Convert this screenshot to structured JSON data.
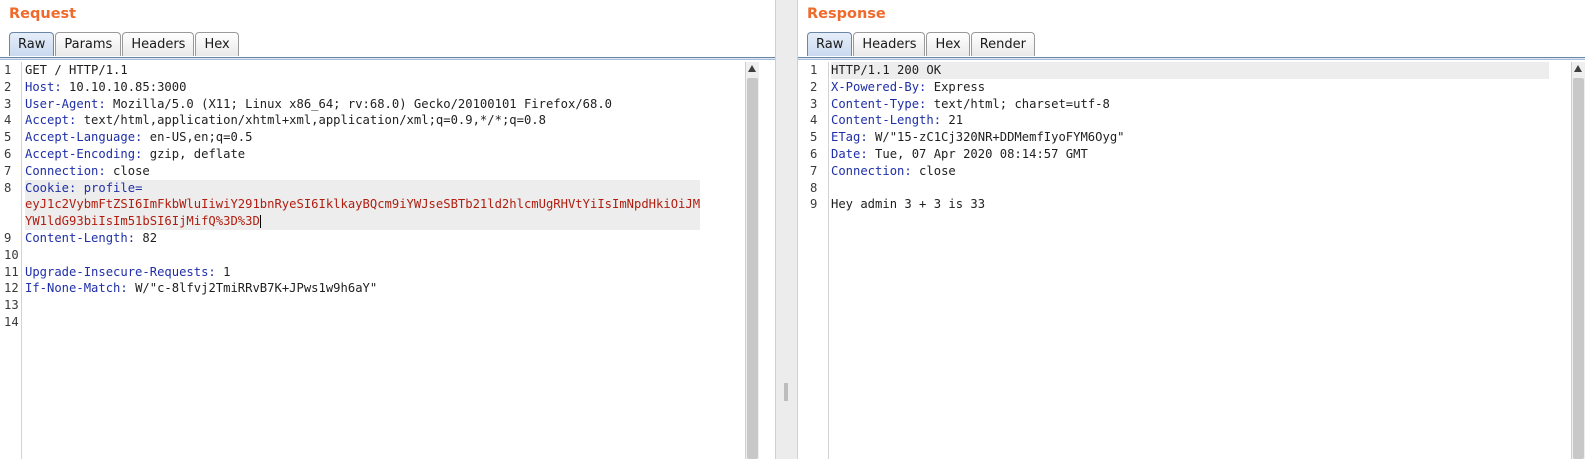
{
  "request": {
    "title": "Request",
    "tabs": [
      "Raw",
      "Params",
      "Headers",
      "Hex"
    ],
    "active_tab": "Raw",
    "line_numbers": [
      "1",
      "2",
      "3",
      "4",
      "5",
      "6",
      "7",
      "8",
      "9",
      "10",
      "11",
      "12",
      "13",
      "14"
    ],
    "lines": {
      "l1": "GET / HTTP/1.1",
      "host_name": "Host:",
      "host_value": " 10.10.10.85:3000",
      "ua_name": "User-Agent:",
      "ua_value": " Mozilla/5.0 (X11; Linux x86_64; rv:68.0) Gecko/20100101 Firefox/68.0",
      "accept_name": "Accept:",
      "accept_value": " text/html,application/xhtml+xml,application/xml;q=0.9,*/*;q=0.8",
      "lang_name": "Accept-Language:",
      "lang_value": " en-US,en;q=0.5",
      "enc_name": "Accept-Encoding:",
      "enc_value": " gzip, deflate",
      "conn_name": "Connection:",
      "conn_value": " close",
      "cookie_name": "Cookie:",
      "cookie_key": " profile=",
      "cookie_value_1": "eyJ1c2VybmFtZSI6ImFkbWluIiwiY291bnRyeSI6IklkayBQcm9iYWJseSBTb21ld2hlcmUgRHVtYiIsImNpdHkiOiJM",
      "cookie_value_2": "YW1ldG93biIsIm51bSI6IjMifQ%3D%3D",
      "cl_name": "Content-Length:",
      "cl_value": " 82",
      "uir_name": "Upgrade-Insecure-Requests:",
      "uir_value": " 1",
      "inm_name": "If-None-Match:",
      "inm_value": " W/\"c-8lfvj2TmiRRvB7K+JPws1w9h6aY\""
    }
  },
  "response": {
    "title": "Response",
    "tabs": [
      "Raw",
      "Headers",
      "Hex",
      "Render"
    ],
    "active_tab": "Raw",
    "line_numbers": [
      "1",
      "2",
      "3",
      "4",
      "5",
      "6",
      "7",
      "8",
      "9"
    ],
    "lines": {
      "l1": "HTTP/1.1 200 OK",
      "xpb_name": "X-Powered-By:",
      "xpb_value": " Express",
      "ct_name": "Content-Type:",
      "ct_value": " text/html; charset=utf-8",
      "cl_name": "Content-Length:",
      "cl_value": " 21",
      "etag_name": "ETag:",
      "etag_value": " W/\"15-zC1Cj320NR+DDMemfIyoFYM6Oyg\"",
      "date_name": "Date:",
      "date_value": " Tue, 07 Apr 2020 08:14:57 GMT",
      "conn_name": "Connection:",
      "conn_value": " close",
      "body": "Hey admin 3 + 3 is 33"
    }
  },
  "colors": {
    "title": "#ef6a2b",
    "header_name": "#1f2fa8",
    "cookie_value": "#b01e10"
  }
}
